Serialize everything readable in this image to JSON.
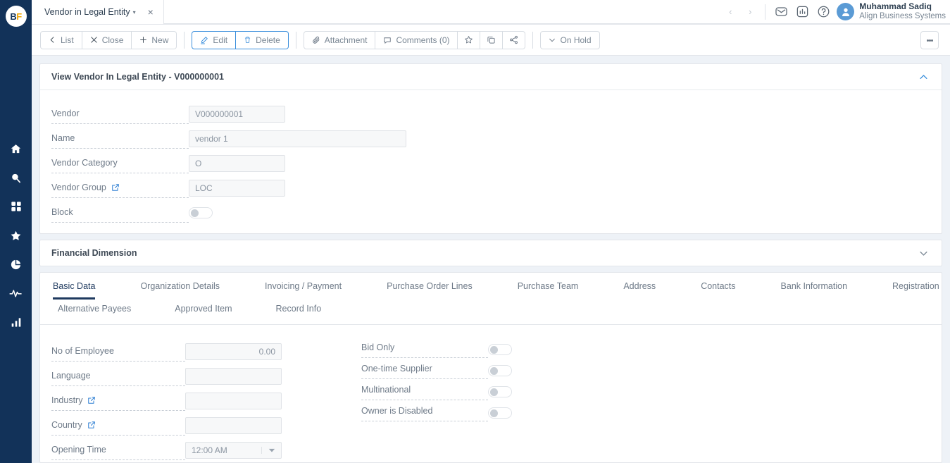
{
  "app": {
    "logo_b": "B",
    "logo_f": "F"
  },
  "sidebar": {
    "items": [
      {
        "name": "home-icon",
        "label": "Home"
      },
      {
        "name": "search-icon",
        "label": "Search"
      },
      {
        "name": "apps-grid-icon",
        "label": "Apps"
      },
      {
        "name": "star-icon",
        "label": "Favorites"
      },
      {
        "name": "pie-chart-icon",
        "label": "Reports"
      },
      {
        "name": "activity-pulse-icon",
        "label": "Activity"
      },
      {
        "name": "bar-chart-icon",
        "label": "Analytics"
      }
    ]
  },
  "topbar": {
    "tab_label": "Vendor in Legal Entity",
    "tab_caret": "▾",
    "tab_close": "×",
    "nav_prev": "‹",
    "nav_next": "›",
    "icons": [
      "mail-icon",
      "chart-icon",
      "help-icon"
    ],
    "user_name": "Muhammad Sadiq",
    "user_org": "Align Business Systems"
  },
  "toolbar": {
    "list_label": "List",
    "close_label": "Close",
    "new_label": "New",
    "edit_label": "Edit",
    "delete_label": "Delete",
    "attachment_label": "Attachment",
    "comments_label": "Comments (0)",
    "favorite_icon": "star-icon",
    "duplicate_icon": "copy-icon",
    "share_icon": "share-icon",
    "onhold_label": "On Hold",
    "onhold_caret": "⌄",
    "kebab_label": "More options"
  },
  "header_panel": {
    "title": "View Vendor In Legal Entity - V000000001",
    "expanded": true,
    "fields": [
      {
        "label": "Vendor",
        "value": "V000000001",
        "type": "text",
        "width": "w140",
        "link": false
      },
      {
        "label": "Name",
        "value": "vendor 1",
        "type": "text",
        "width": "w310",
        "link": false
      },
      {
        "label": "Vendor Category",
        "value": "O",
        "type": "text",
        "width": "w140",
        "link": false
      },
      {
        "label": "Vendor Group",
        "value": "LOC",
        "type": "text",
        "width": "w140",
        "link": true
      },
      {
        "label": "Block",
        "value": "",
        "type": "toggle",
        "width": "",
        "link": false
      }
    ]
  },
  "financial_panel": {
    "title": "Financial Dimension",
    "expanded": false
  },
  "tabs": {
    "row1": [
      {
        "label": "Basic Data",
        "active": true
      },
      {
        "label": "Organization Details",
        "active": false
      },
      {
        "label": "Invoicing / Payment",
        "active": false
      },
      {
        "label": "Purchase Order Lines",
        "active": false
      },
      {
        "label": "Purchase Team",
        "active": false
      },
      {
        "label": "Address",
        "active": false
      },
      {
        "label": "Contacts",
        "active": false
      },
      {
        "label": "Bank Information",
        "active": false
      },
      {
        "label": "Registration",
        "active": false
      }
    ],
    "row2": [
      {
        "label": "Alternative Payees",
        "active": false
      },
      {
        "label": "Approved Item",
        "active": false
      },
      {
        "label": "Record Info",
        "active": false
      }
    ]
  },
  "basic_data": {
    "left_fields": [
      {
        "label": "No of Employee",
        "value": "0.00",
        "type": "number",
        "link": false
      },
      {
        "label": "Language",
        "value": "",
        "type": "text",
        "link": false
      },
      {
        "label": "Industry",
        "value": "",
        "type": "text",
        "link": true
      },
      {
        "label": "Country",
        "value": "",
        "type": "text",
        "link": true
      },
      {
        "label": "Opening Time",
        "value": "12:00 AM",
        "type": "dropdown",
        "link": false
      }
    ],
    "right_fields": [
      {
        "label": "Bid Only",
        "type": "toggle",
        "on": false
      },
      {
        "label": "One-time Supplier",
        "type": "toggle",
        "on": false
      },
      {
        "label": "Multinational",
        "type": "toggle",
        "on": false
      },
      {
        "label": "Owner is Disabled",
        "type": "toggle",
        "on": false
      }
    ]
  },
  "colors": {
    "rail": "#123259",
    "accent_blue": "#3b8fdc",
    "page_bg": "#eef2f7",
    "logo_gold": "#f0a500",
    "tab_active": "#1f3a5f"
  }
}
